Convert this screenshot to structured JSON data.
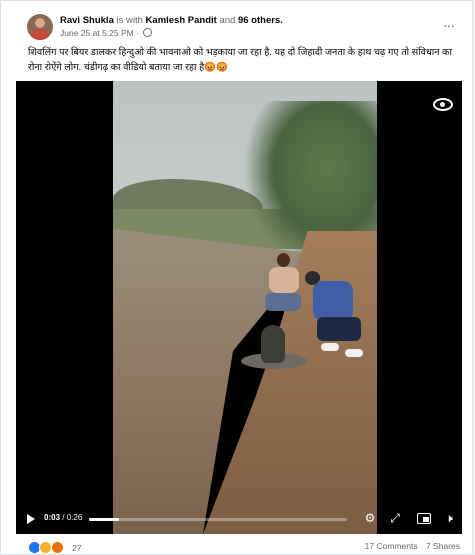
{
  "post": {
    "author": "Ravi Shukla",
    "is_with_text": "is with",
    "tagged": "Kamlesh Pandit",
    "and_text": "and",
    "others": "96 others.",
    "date": "June 25 at 5:25 PM",
    "separator": "·",
    "more": "···",
    "caption": "शिवलिंग पर बियर डालकर हिन्दुओ की भावनाओ को भड़काया जा रहा है. यह दो जिहादी जनता के हाथ चढ़ गए तो संविधान का रोना रोऐंगे लोग. चंडीगढ़ का वीडियो बताया जा रहा है😡😡"
  },
  "video": {
    "current_time": "0:03",
    "duration_sep": "/",
    "duration": "0:26",
    "progress_fraction": 0.115
  },
  "footer": {
    "reaction_count": "27",
    "comments": "17 Comments",
    "shares": "7 Shares"
  },
  "icons": {
    "reactions": [
      "like-icon",
      "haha-icon",
      "angry-icon"
    ],
    "controls": [
      "play-icon",
      "gear-icon",
      "expand-icon",
      "pip-icon",
      "volume-icon"
    ]
  },
  "colors": {
    "link_blue": "#1877f2",
    "muted": "#65676b",
    "text": "#050505"
  }
}
